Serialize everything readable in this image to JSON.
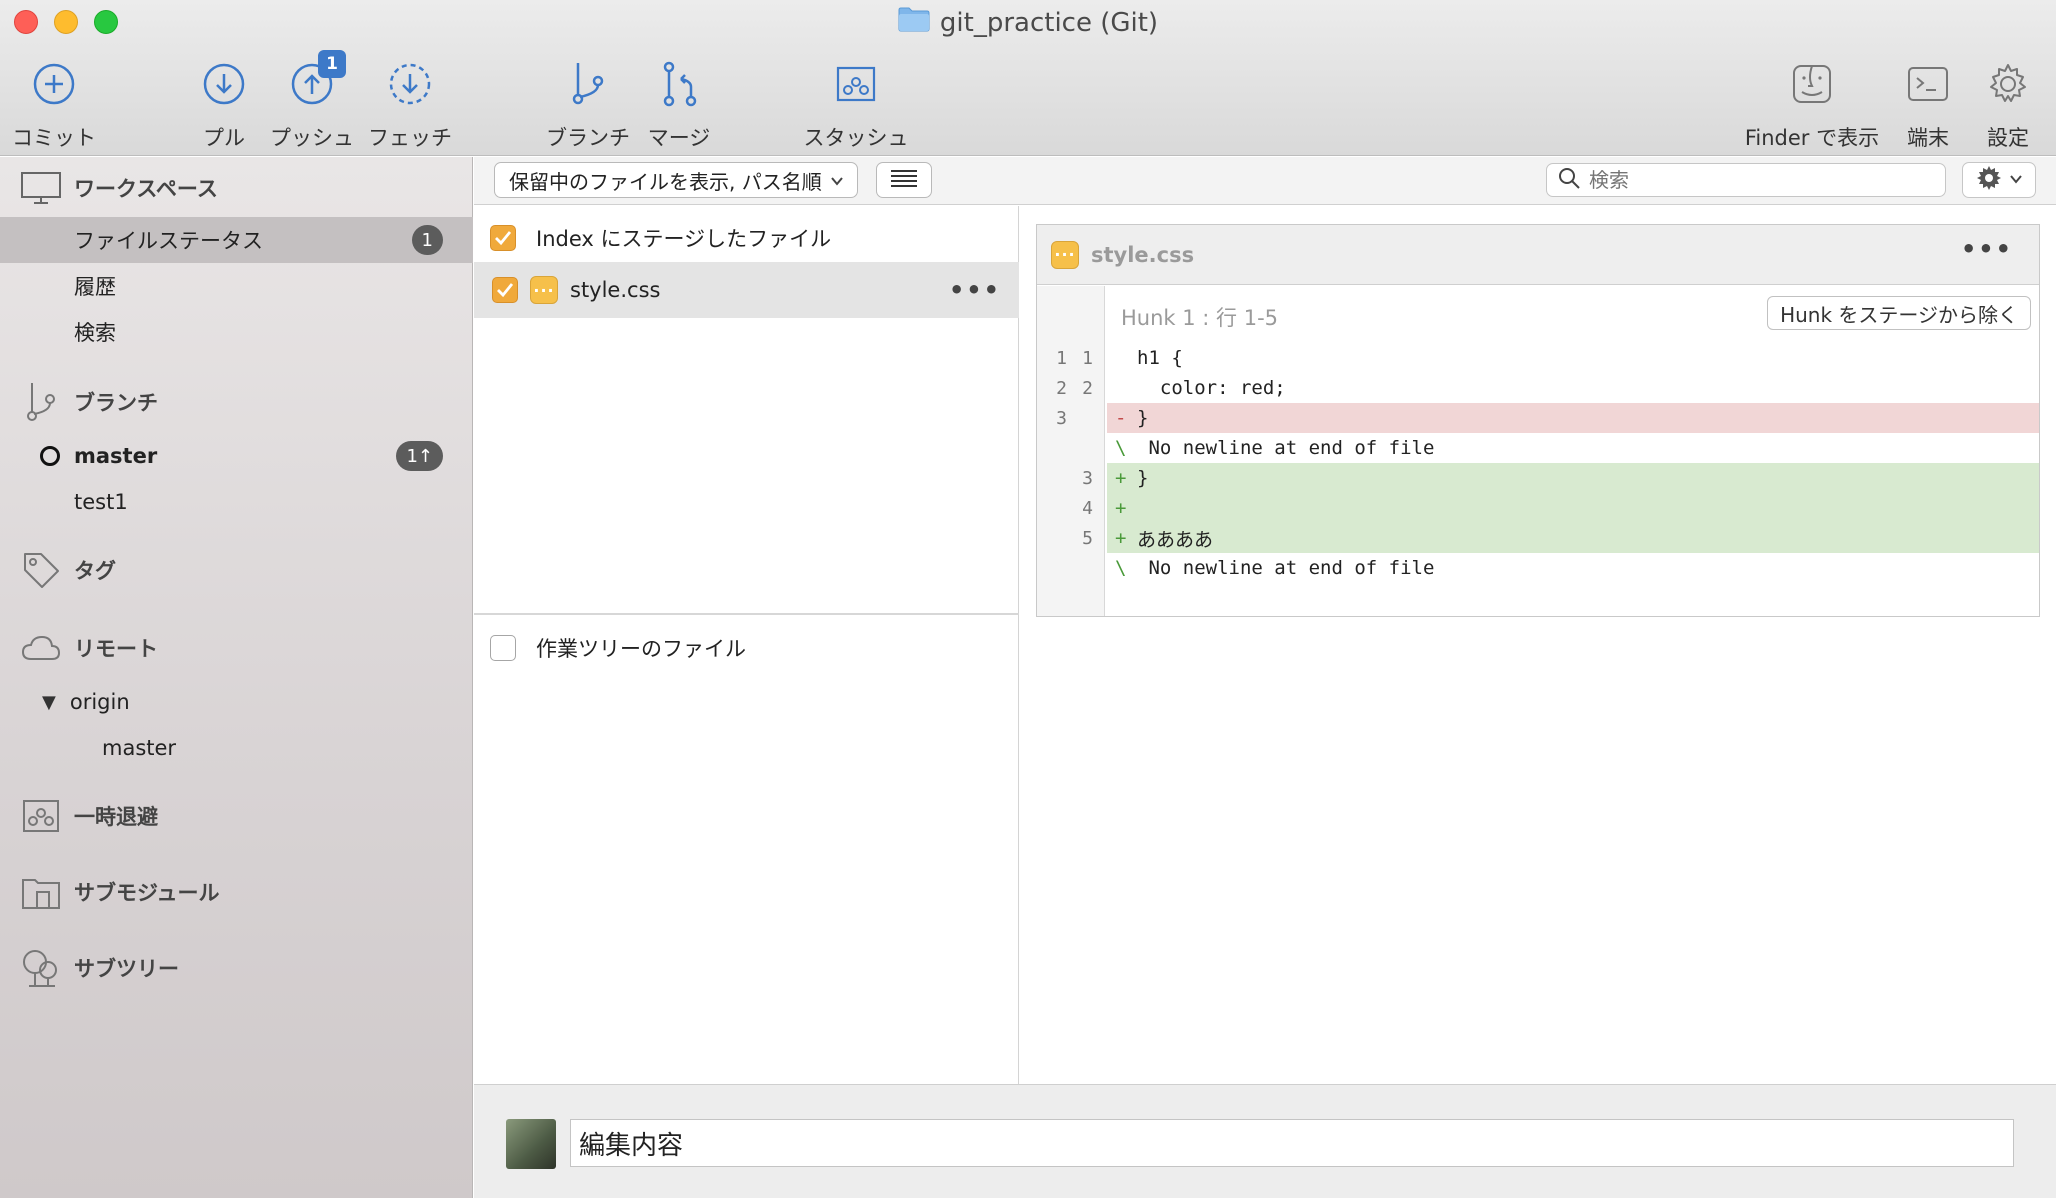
{
  "window": {
    "title": "git_practice (Git)"
  },
  "toolbar": {
    "commit": "コミット",
    "pull": "プル",
    "push": "プッシュ",
    "push_badge": "1",
    "fetch": "フェッチ",
    "branch": "ブランチ",
    "merge": "マージ",
    "stash": "スタッシュ",
    "finder": "Finder で表示",
    "terminal": "端末",
    "settings": "設定"
  },
  "sidebar": {
    "workspace": {
      "label": "ワークスペース",
      "items": [
        {
          "label": "ファイルステータス",
          "count": "1",
          "selected": true
        },
        {
          "label": "履歴"
        },
        {
          "label": "検索"
        }
      ]
    },
    "branches": {
      "label": "ブランチ",
      "items": [
        {
          "label": "master",
          "count": "1↑",
          "current": true
        },
        {
          "label": "test1"
        }
      ]
    },
    "tags": {
      "label": "タグ"
    },
    "remotes": {
      "label": "リモート",
      "items": [
        {
          "label": "origin",
          "children": [
            {
              "label": "master"
            }
          ]
        }
      ]
    },
    "stashes": {
      "label": "一時退避"
    },
    "submodules": {
      "label": "サブモジュール"
    },
    "subtrees": {
      "label": "サブツリー"
    }
  },
  "filterbar": {
    "dropdown": "保留中のファイルを表示, パス名順",
    "search_placeholder": "検索"
  },
  "staged": {
    "header": "Index にステージしたファイル",
    "files": [
      {
        "name": "style.css"
      }
    ]
  },
  "unstaged": {
    "header": "作業ツリーのファイル"
  },
  "diff": {
    "file": "style.css",
    "hunk_label": "Hunk 1 : 行 1-5",
    "hunk_button": "Hunk をステージから除く",
    "lines": [
      {
        "old": "1",
        "new": "1",
        "type": "ctx",
        "mark": "",
        "text": "h1 {"
      },
      {
        "old": "2",
        "new": "2",
        "type": "ctx",
        "mark": "",
        "text": "  color: red;"
      },
      {
        "old": "3",
        "new": "",
        "type": "del",
        "mark": "-",
        "text": "}"
      },
      {
        "old": "",
        "new": "",
        "type": "nonl",
        "mark": "\\",
        "text": " No newline at end of file"
      },
      {
        "old": "",
        "new": "3",
        "type": "add",
        "mark": "+",
        "text": "}"
      },
      {
        "old": "",
        "new": "4",
        "type": "add",
        "mark": "+",
        "text": ""
      },
      {
        "old": "",
        "new": "5",
        "type": "add",
        "mark": "+",
        "text": "ああああ"
      },
      {
        "old": "",
        "new": "",
        "type": "nonl",
        "mark": "\\",
        "text": " No newline at end of file"
      }
    ]
  },
  "commit": {
    "message": "編集内容"
  },
  "colors": {
    "accent": "#3d79c8",
    "checkbox": "#f0a93b",
    "deleted_bg": "#f1d6d6",
    "added_bg": "#d8ead0"
  }
}
